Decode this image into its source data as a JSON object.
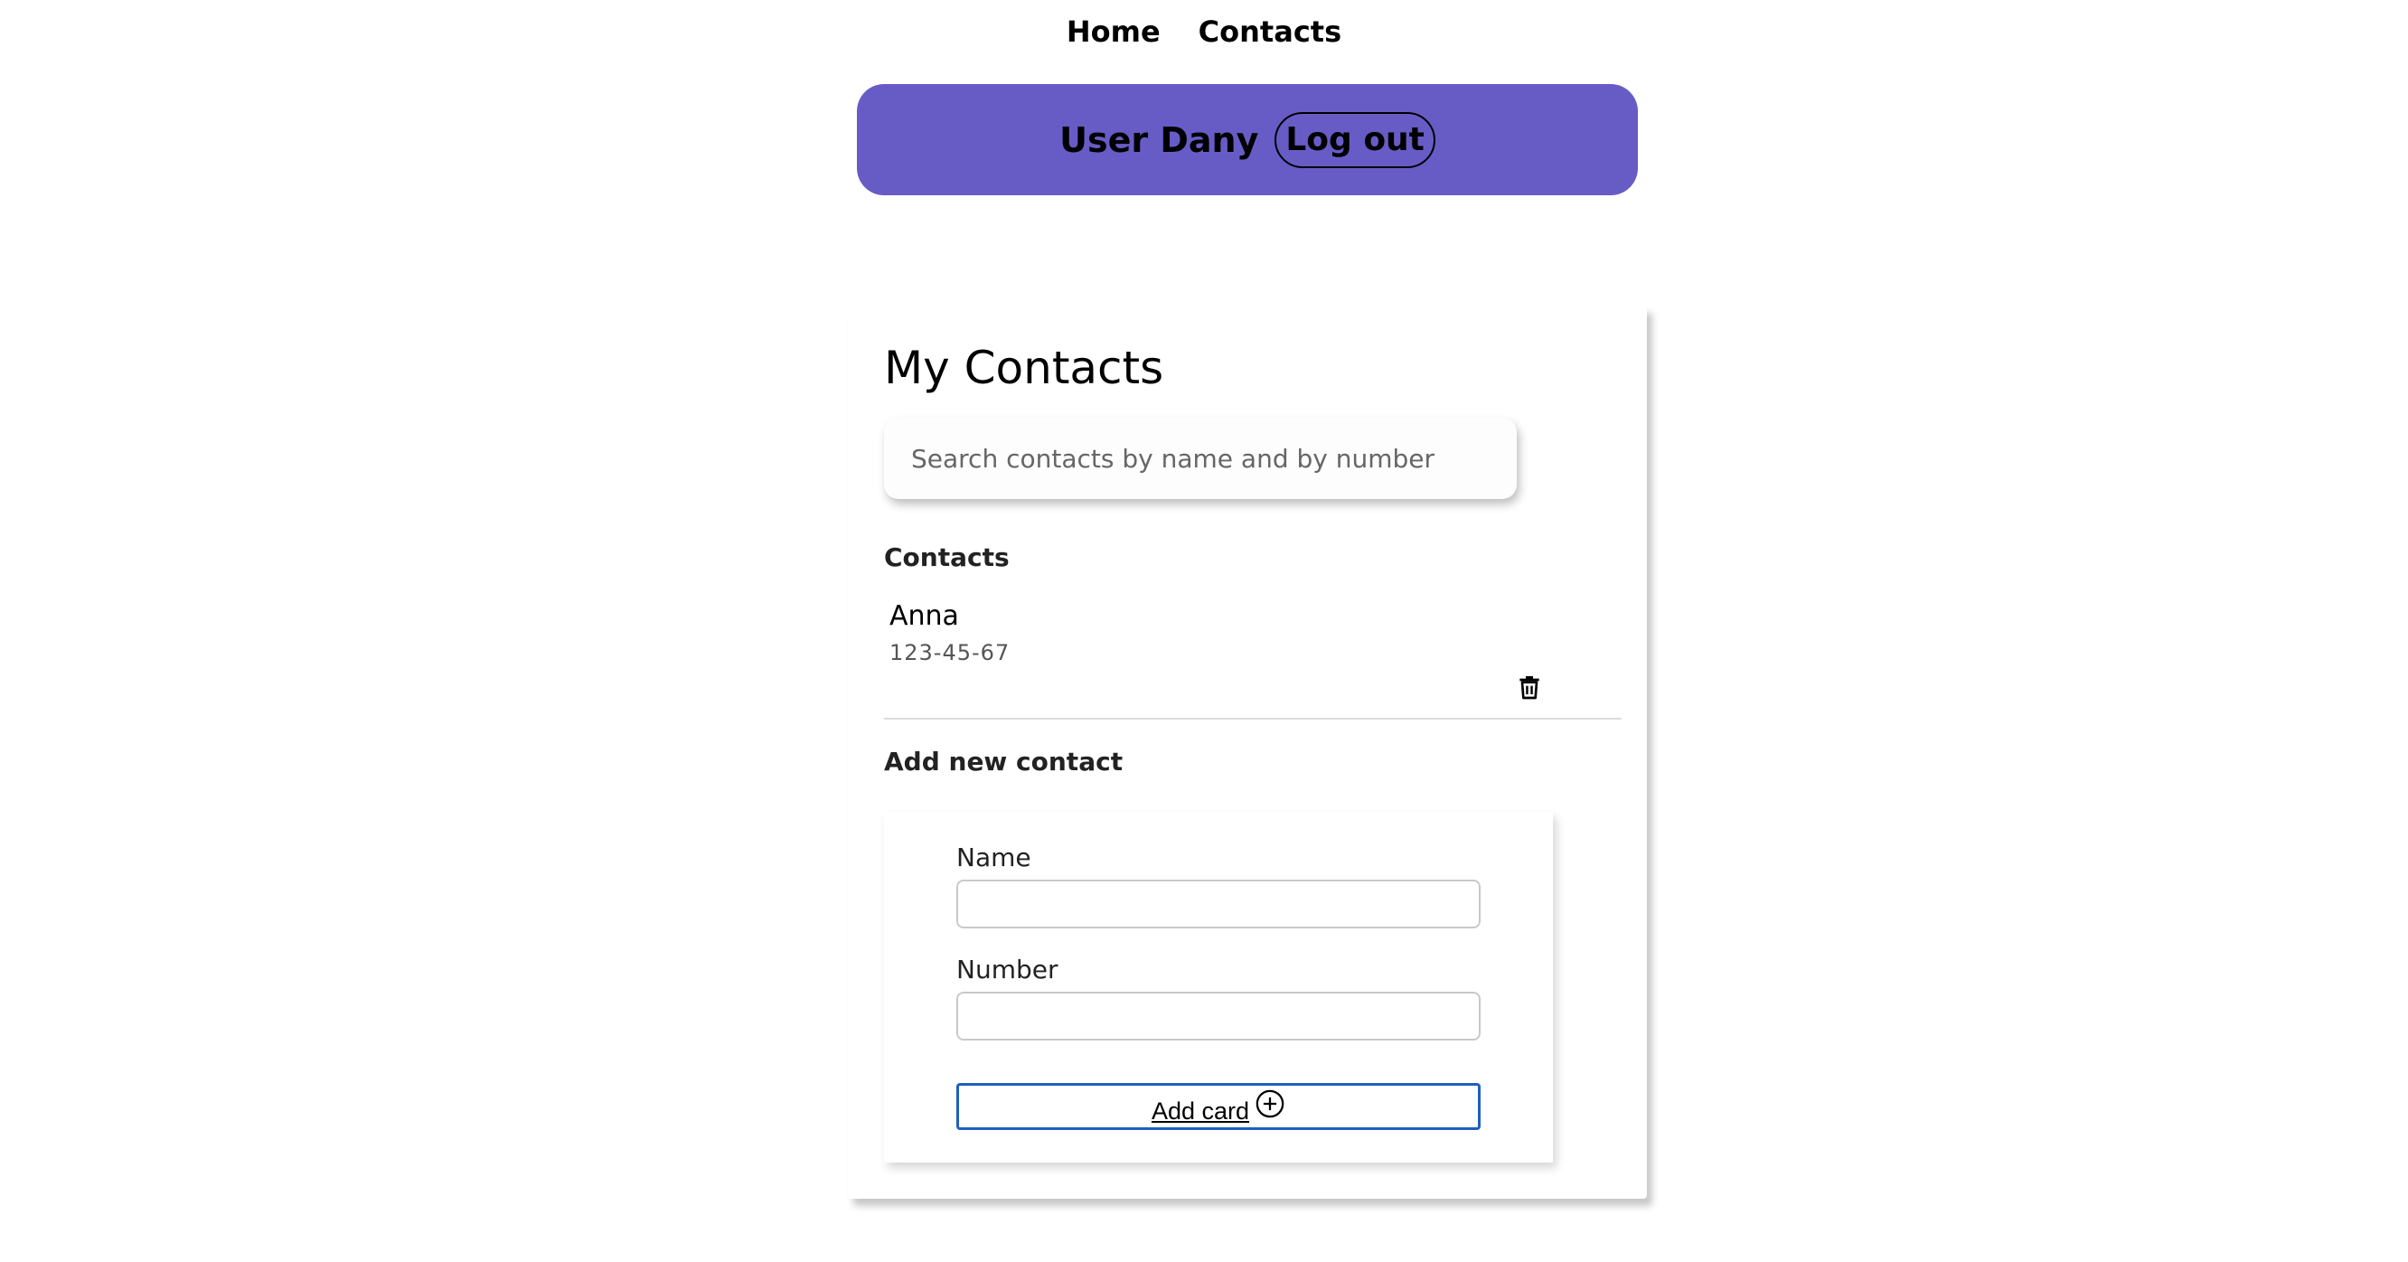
{
  "nav": {
    "links": [
      "Home",
      "Contacts"
    ]
  },
  "user_bar": {
    "user_label": "User Dany",
    "logout_label": "Log out",
    "background_color": "#675cc6"
  },
  "contacts_card": {
    "title": "My Contacts",
    "search": {
      "placeholder": "Search contacts by name and by number",
      "value": ""
    },
    "list_heading": "Contacts",
    "contacts": [
      {
        "name": "Anna",
        "number": "123-45-67",
        "action_icon": "trash-icon"
      }
    ],
    "add_heading": "Add new contact",
    "form": {
      "name_label": "Name",
      "name_value": "",
      "number_label": "Number",
      "number_value": "",
      "submit_label": "Add card",
      "submit_icon": "plus-circle-icon",
      "submit_border_color": "#1f5fbf"
    }
  }
}
